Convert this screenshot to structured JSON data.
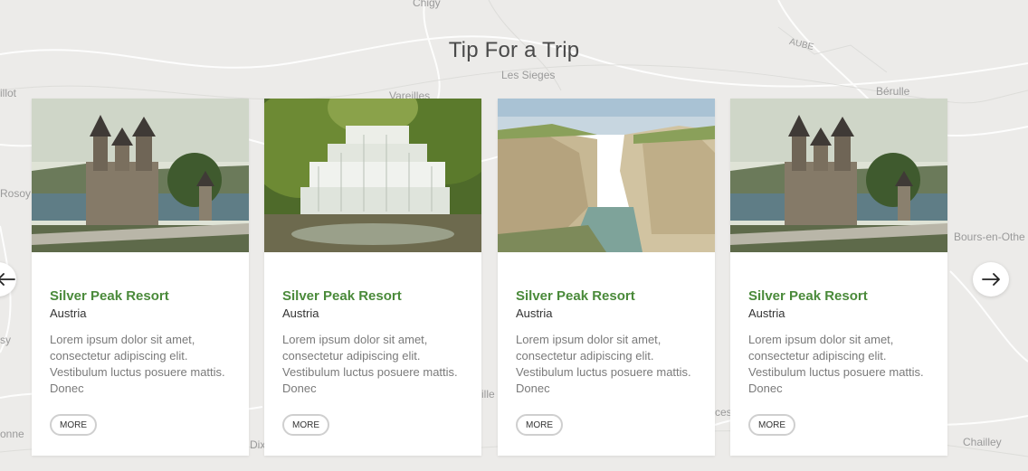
{
  "section": {
    "title": "Tip For a Trip"
  },
  "map_labels": [
    "Chigy",
    "Les Sieges",
    "Vareilles",
    "illot",
    "Bérulle",
    "Rosoy",
    "Bours-en-Othe",
    "sy",
    "ille",
    "ces",
    "Dix",
    "onne",
    "Chailley",
    "AUBE"
  ],
  "cards": [
    {
      "name": "Silver Peak Resort",
      "country": "Austria",
      "description": "Lorem ipsum dolor sit amet, consectetur adipiscing elit. Vestibulum luctus posuere mattis. Donec",
      "more_label": "MORE",
      "image": "castle"
    },
    {
      "name": "Silver Peak Resort",
      "country": "Austria",
      "description": "Lorem ipsum dolor sit amet, consectetur adipiscing elit. Vestibulum luctus posuere mattis. Donec",
      "more_label": "MORE",
      "image": "waterfall"
    },
    {
      "name": "Silver Peak Resort",
      "country": "Austria",
      "description": "Lorem ipsum dolor sit amet, consectetur adipiscing elit. Vestibulum luctus posuere mattis. Donec",
      "more_label": "MORE",
      "image": "cliffs"
    },
    {
      "name": "Silver Peak Resort",
      "country": "Austria",
      "description": "Lorem ipsum dolor sit amet, consectetur adipiscing elit. Vestibulum luctus posuere mattis. Donec",
      "more_label": "MORE",
      "image": "castle"
    }
  ],
  "controls": {
    "prev_icon": "arrow-left-icon",
    "next_icon": "arrow-right-icon"
  },
  "colors": {
    "accent": "#4a8a3a",
    "background": "#ecebe9"
  }
}
